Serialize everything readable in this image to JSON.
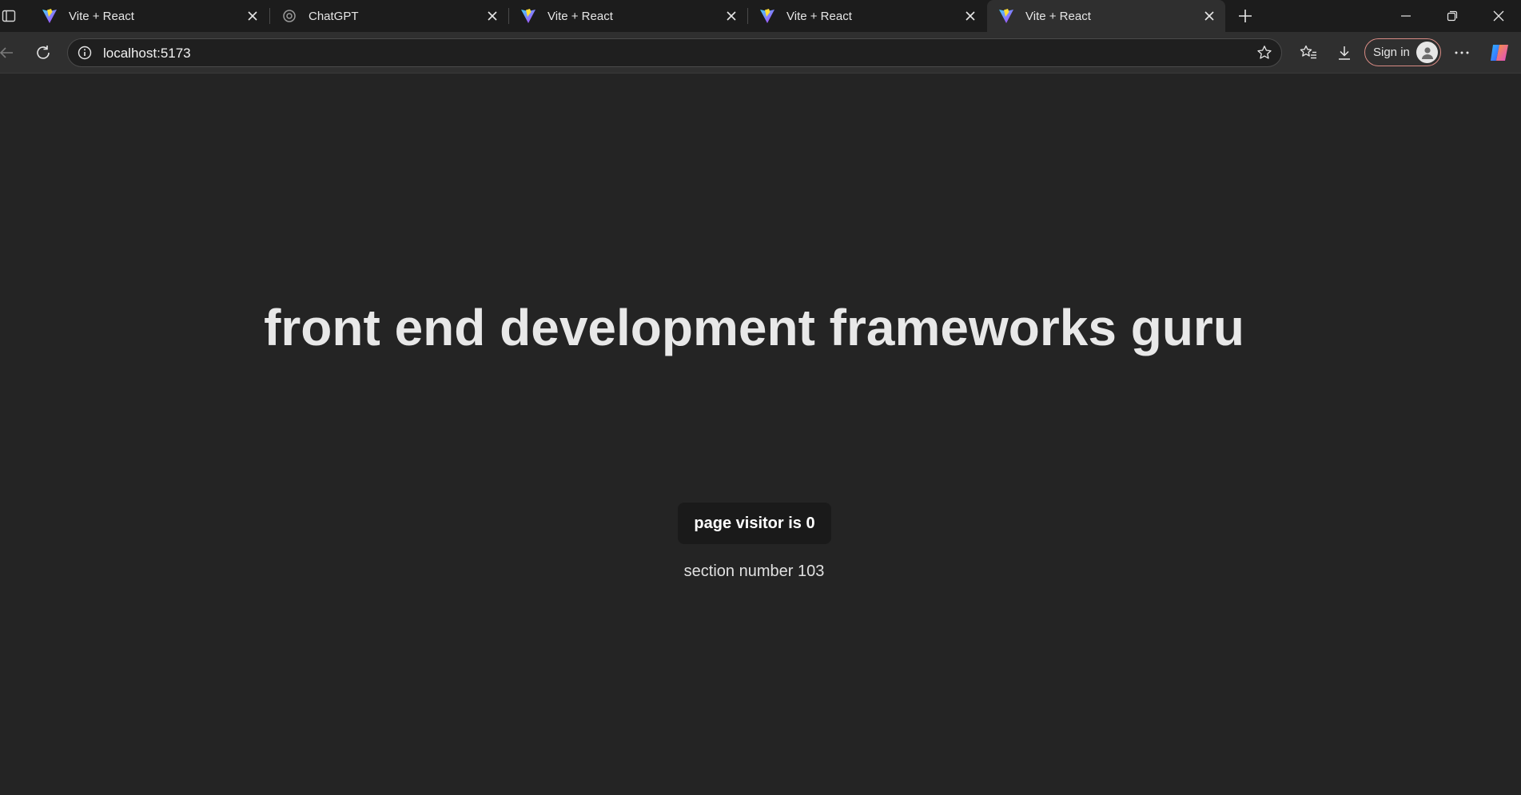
{
  "browser": {
    "tabs": [
      {
        "title": "Vite + React",
        "favicon": "vite-icon",
        "active": false
      },
      {
        "title": "ChatGPT",
        "favicon": "chatgpt-icon",
        "active": false
      },
      {
        "title": "Vite + React",
        "favicon": "vite-icon",
        "active": false
      },
      {
        "title": "Vite + React",
        "favicon": "vite-icon",
        "active": false
      },
      {
        "title": "Vite + React",
        "favicon": "vite-icon",
        "active": true
      }
    ],
    "address": "localhost:5173",
    "signin_label": "Sign in"
  },
  "page": {
    "heading": "front end development frameworks guru",
    "visitor_button": "page visitor is 0",
    "section_text": "section number 103"
  },
  "colors": {
    "page_background": "#242424",
    "button_background": "#1a1a1a",
    "signin_border": "#d88b84"
  }
}
